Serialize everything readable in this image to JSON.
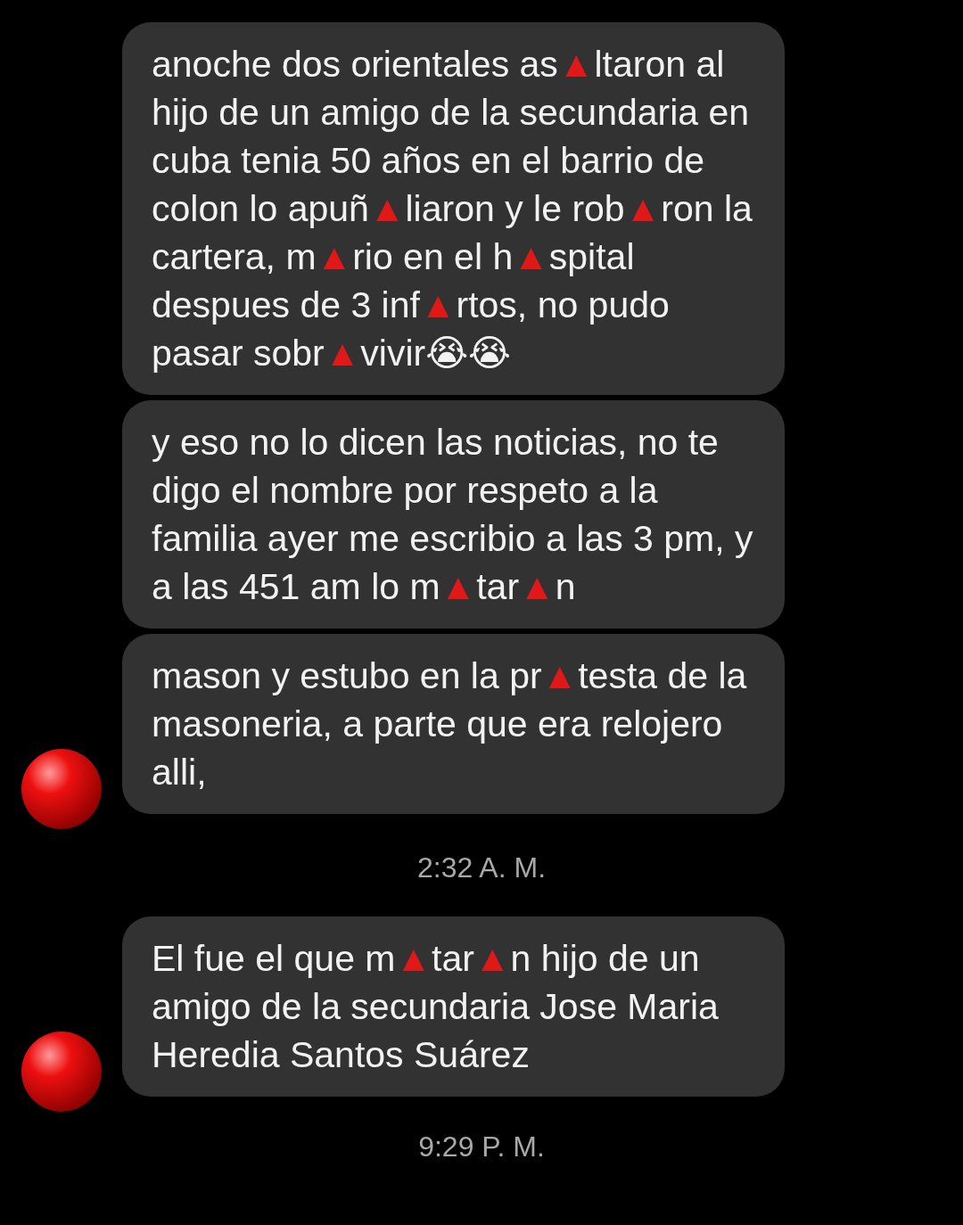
{
  "messages": [
    {
      "text": "anoche dos orientales as▲ltaron al hijo de un amigo de la secundaria en cuba tenia 50 años en el barrio de colon lo apuñ▲liaron y le rob▲ron la cartera, m▲rio en el h▲spital despues de 3 inf▲rtos, no pudo pasar sobr▲vivir😭😭"
    },
    {
      "text": "y eso no lo dicen las noticias, no te digo el nombre por respeto a la familia ayer me escribio a las 3 pm, y a las 451 am lo m▲tar▲n"
    },
    {
      "text": "mason y estubo en la pr▲testa de la masoneria, a parte que era relojero alli,",
      "avatar": true
    },
    {
      "timestamp": "2:32 A. M."
    },
    {
      "text": "El fue el que m▲tar▲n hijo de un amigo de la secundaria Jose Maria Heredia Santos Suárez",
      "avatar": true
    },
    {
      "timestamp": "9:29 P. M."
    }
  ]
}
